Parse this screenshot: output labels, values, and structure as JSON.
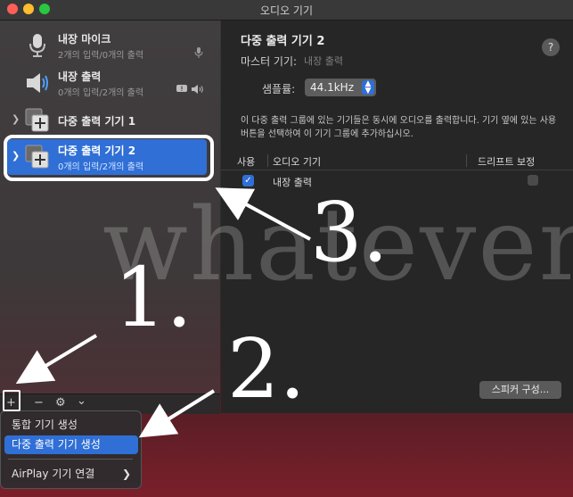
{
  "window": {
    "title": "오디오 기기"
  },
  "sidebar": {
    "devices": [
      {
        "name": "내장 마이크",
        "sub": "2개의 입력/0개의 출력",
        "icon": "microphone-icon"
      },
      {
        "name": "내장 출력",
        "sub": "0개의 입력/2개의 출력",
        "icon": "speaker-icon"
      },
      {
        "name": "다중 출력 기기 1",
        "sub": "",
        "icon": "multi-output-icon"
      },
      {
        "name": "다중 출력 기기 2",
        "sub": "0개의 입력/2개의 출력",
        "icon": "multi-output-icon"
      }
    ],
    "toolbar": {
      "add": "+",
      "remove": "−",
      "gear": "⚙",
      "chevron": "⌄"
    }
  },
  "main": {
    "title": "다중 출력 기기 2",
    "master_label": "마스터 기기:",
    "master_value": "내장 출력",
    "sample_rate_label": "샘플률:",
    "sample_rate_value": "44.1kHz",
    "description": "이 다중 출력 그룹에 있는 기기들은 동시에 오디오를 출력합니다. 기기 옆에 있는 사용 버튼을 선택하여 이 기기 그룹에 추가하십시오.",
    "table": {
      "headers": {
        "use": "사용",
        "device": "오디오 기기",
        "drift": "드리프트 보정"
      },
      "rows": [
        {
          "use": true,
          "device": "내장 출력",
          "drift": false
        }
      ]
    },
    "speaker_button": "스피커 구성...",
    "help": "?"
  },
  "menu": {
    "items": [
      {
        "label": "통합 기기 생성"
      },
      {
        "label": "다중 출력 기기 생성"
      },
      {
        "label": "AirPlay 기기 연결"
      }
    ]
  },
  "overlay": {
    "watermark": "whatever",
    "steps": [
      "1.",
      "2.",
      "3."
    ]
  },
  "colors": {
    "accent": "#2f6fd6",
    "annotation": "#ffffff"
  }
}
